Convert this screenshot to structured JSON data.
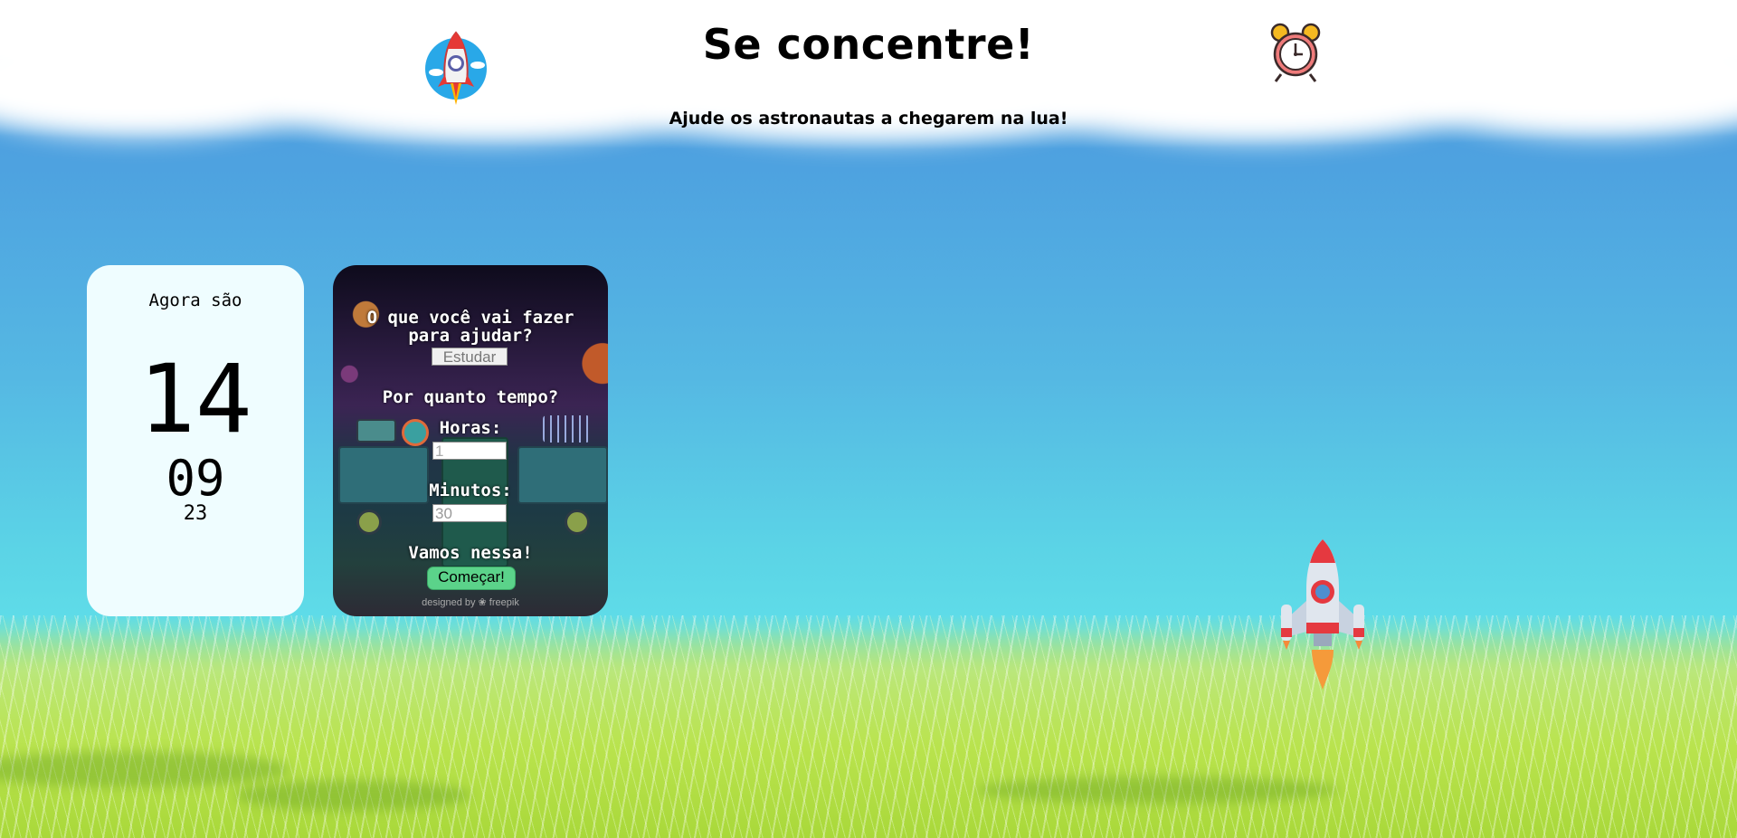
{
  "header": {
    "title": "Se concentre!",
    "subtitle": "Ajude os astronautas a chegarem na lua!",
    "logo_icon": "rocket-astronaut-logo-icon",
    "alarm_icon": "alarm-clock-icon"
  },
  "clock": {
    "label": "Agora são",
    "hours": "14",
    "minutes": "09",
    "seconds": "23"
  },
  "form": {
    "question": "O que você vai fazer para ajudar?",
    "task_value": "Estudar",
    "duration_question": "Por quanto tempo?",
    "hours_label": "Horas:",
    "hours_placeholder": "1",
    "minutes_label": "Minutos:",
    "minutes_placeholder": "30",
    "cta_text": "Vamos nessa!",
    "start_button": "Começar!",
    "credit": "designed by ❀ freepik"
  },
  "scene": {
    "rocket_icon": "rocket-icon",
    "colors": {
      "sky_top": "#4a9adf",
      "sky_bottom": "#5fdde8",
      "grass": "#b6e35a",
      "clock_card": "#effdff",
      "start_button": "#5bd38a"
    }
  }
}
